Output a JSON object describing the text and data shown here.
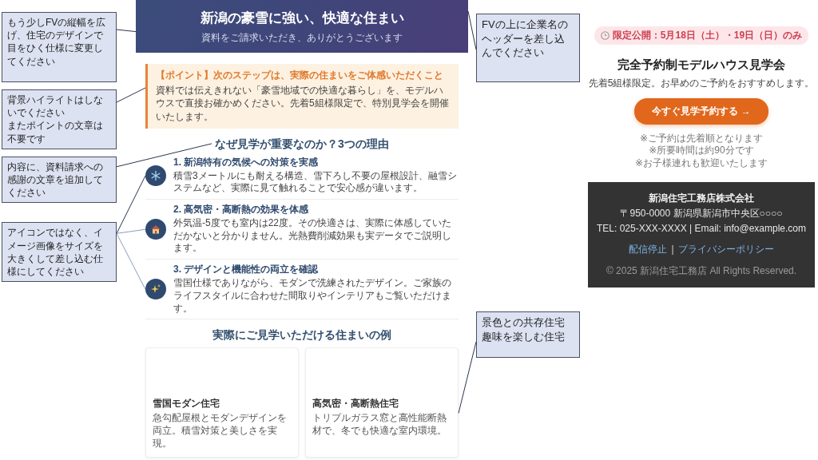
{
  "notes_left": [
    {
      "lines": [
        "もう少しFVの縦幅を広げ、住宅のデザインで目をひく仕様に変更してください"
      ]
    },
    {
      "lines": [
        "背景ハイライトはしないでください",
        "またポイントの文章は不要です"
      ]
    },
    {
      "lines": [
        "内容に、資料請求への感謝の文章を追加してください"
      ]
    },
    {
      "lines": [
        "アイコンではなく、イメージ画像をサイズを大きくして差し込む仕様にしてください"
      ]
    }
  ],
  "email_preview": {
    "hero": {
      "title": "新潟の豪雪に強い、快適な住まい",
      "subtitle": "資料をご請求いただき、ありがとうございます"
    },
    "point": {
      "title": "【ポイント】次のステップは、実際の住まいをご体感いただくこと",
      "body": "資料では伝えきれない「豪雪地域での快適な暮らし」を、モデルハウスで直接お確かめください。先着5組様限定で、特別見学会を開催いたします。"
    },
    "reasons": {
      "title": "なぜ見学が重要なのか？3つの理由",
      "items": [
        {
          "title": "1. 新潟特有の気候への対策を実感",
          "body": "積雪3メートルにも耐える構造、雪下ろし不要の屋根設計、融雪システムなど、実際に見て触れることで安心感が違います。"
        },
        {
          "title": "2. 高気密・高断熱の効果を体感",
          "body": "外気温-5度でも室内は22度。その快適さは、実際に体感していただかないと分かりません。光熱費削減効果も実データでご説明します。"
        },
        {
          "title": "3. デザインと機能性の両立を確認",
          "body": "雪国仕様でありながら、モダンで洗練されたデザイン。ご家族のライフスタイルに合わせた間取りやインテリアもご覧いただけます。"
        }
      ]
    },
    "examples": {
      "title": "実際にご見学いただける住まいの例",
      "cards": [
        {
          "title": "雪国モダン住宅",
          "body": "急勾配屋根とモダンデザインを両立。積雪対策と美しさを実現。"
        },
        {
          "title": "高気密・高断熱住宅",
          "body": "トリプルガラス窓と高性能断熱材で、冬でも快適な室内環境。"
        }
      ]
    }
  },
  "notes_right": [
    {
      "lines": [
        "FVの上に企業名のヘッダーを差し込んでください"
      ]
    },
    {
      "lines": [
        "景色との共存住宅",
        "趣味を楽しむ住宅"
      ]
    }
  ],
  "event_preview": {
    "badge": "限定公開：5月18日（土）・19日（日）のみ",
    "title": "完全予約制モデルハウス見学会",
    "subtitle": "先着5組様限定。お早めのご予約をおすすめします。",
    "button": "今すぐ見学予約する →",
    "notes": [
      "※ご予約は先着順となります",
      "※所要時間は約90分です",
      "※お子様連れも歓迎いたします"
    ],
    "footer": {
      "company": "新潟住宅工務店株式会社",
      "address": "〒950-0000 新潟県新潟市中央区○○○○",
      "contact": "TEL: 025-XXX-XXXX | Email: info@example.com",
      "links": [
        "配信停止",
        "プライバシーポリシー"
      ],
      "separator": "|",
      "copyright": "© 2025 新潟住宅工務店 All Rights Reserved."
    }
  }
}
